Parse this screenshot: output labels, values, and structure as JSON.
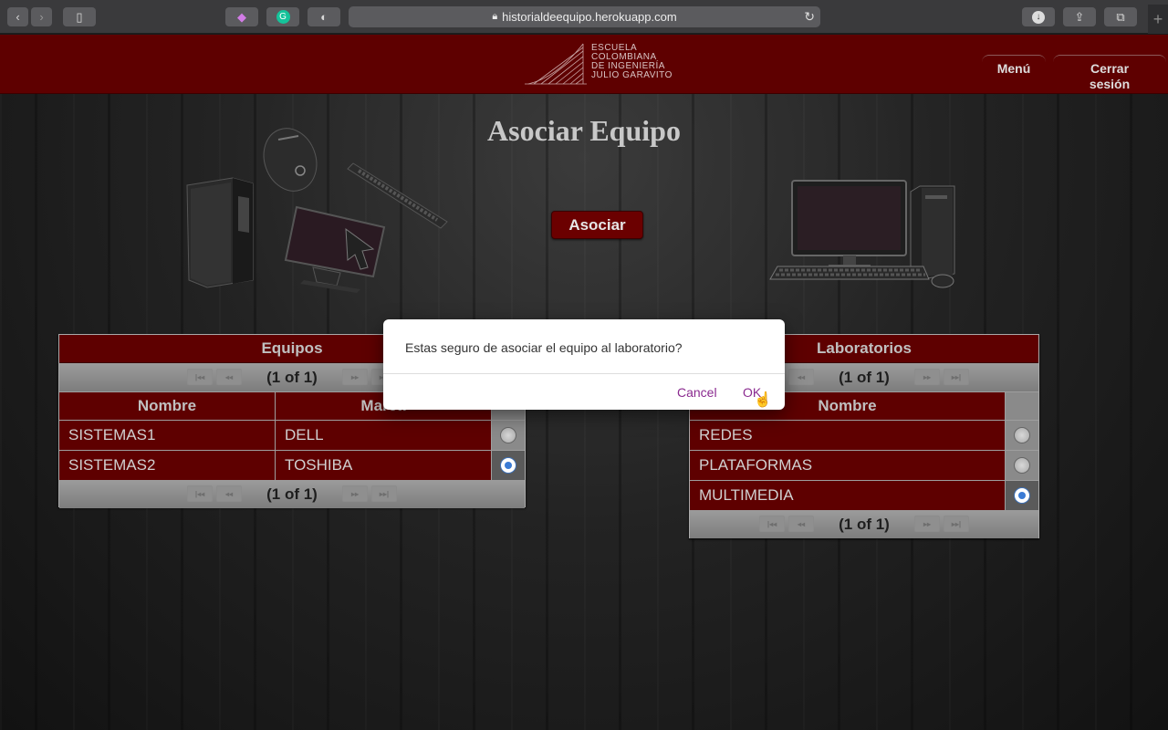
{
  "browser": {
    "url": "historialdeequipo.herokuapp.com",
    "back_icon": "chevron-left-icon",
    "forward_icon": "chevron-right-icon"
  },
  "header": {
    "logo_lines": [
      "ESCUELA",
      "COLOMBIANA",
      "DE INGENIERÍA",
      "JULIO GARAVITO"
    ],
    "menu_label": "Menú",
    "logout_label": "Cerrar sesión"
  },
  "page": {
    "title": "Asociar Equipo",
    "asociar_label": "Asociar"
  },
  "equipos_table": {
    "title": "Equipos",
    "pager_text": "(1 of 1)",
    "columns": [
      "Nombre",
      "Marca"
    ],
    "rows": [
      {
        "nombre": "SISTEMAS1",
        "marca": "DELL",
        "selected": false
      },
      {
        "nombre": "SISTEMAS2",
        "marca": "TOSHIBA",
        "selected": true
      }
    ]
  },
  "laboratorios_table": {
    "title": "Laboratorios",
    "pager_text": "(1 of 1)",
    "columns": [
      "Nombre"
    ],
    "rows": [
      {
        "nombre": "REDES",
        "selected": false
      },
      {
        "nombre": "PLATAFORMAS",
        "selected": false
      },
      {
        "nombre": "MULTIMEDIA",
        "selected": true
      }
    ]
  },
  "dialog": {
    "message": "Estas seguro de asociar el equipo al laboratorio?",
    "cancel_label": "Cancel",
    "ok_label": "OK"
  },
  "colors": {
    "header_bg": "#5e0000",
    "dialog_link": "#8a2a8f",
    "radio_selected": "#3a7bd5"
  }
}
